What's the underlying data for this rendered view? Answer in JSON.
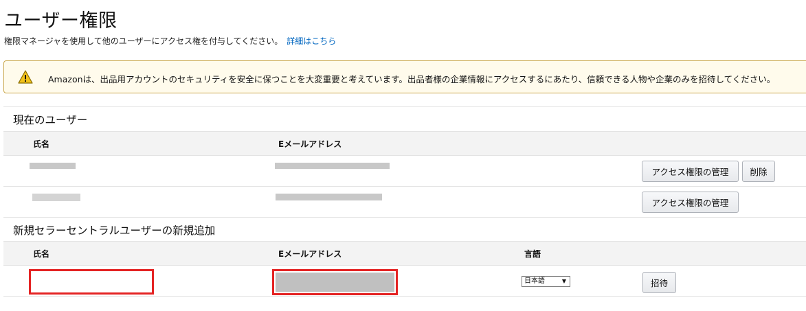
{
  "page": {
    "title": "ユーザー権限",
    "description": "権限マネージャを使用して他のユーザーにアクセス権を付与してください。",
    "learn_more_link": "詳細はこちら"
  },
  "alert": {
    "icon": "warning-icon",
    "message": "Amazonは、出品用アカウントのセキュリティを安全に保つことを大変重要と考えています。出品者様の企業情報にアクセスするにあたり、信頼できる人物や企業のみを招待してください。"
  },
  "current_users": {
    "heading": "現在のユーザー",
    "columns": {
      "name": "氏名",
      "email": "Eメールアドレス"
    },
    "rows": [
      {
        "name": "",
        "email": "",
        "actions": [
          "アクセス権限の管理",
          "削除"
        ]
      },
      {
        "name": "",
        "email": "",
        "actions": [
          "アクセス権限の管理"
        ]
      }
    ]
  },
  "new_user": {
    "heading": "新規セラーセントラルユーザーの新規追加",
    "columns": {
      "name": "氏名",
      "email": "Eメールアドレス",
      "language": "言語"
    },
    "name_value": "",
    "email_value": "",
    "language_selected": "日本語",
    "invite_button": "招待"
  },
  "colors": {
    "link": "#0066c0",
    "alert_bg": "#fffbec",
    "alert_border": "#c9a64a",
    "highlight_red": "#e42323"
  }
}
